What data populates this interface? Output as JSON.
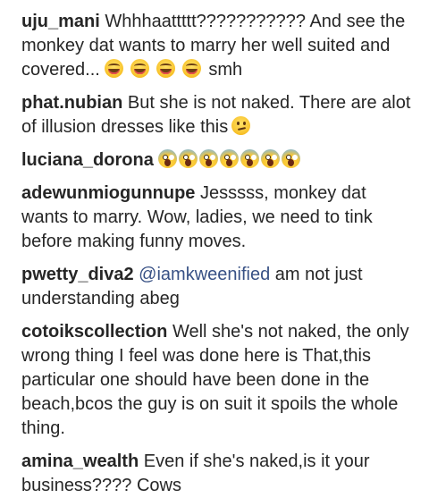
{
  "comments": [
    {
      "username": "uju_mani",
      "text": "Whhhaattttt??????????? And see the monkey dat wants to marry her well suited and covered...",
      "emoji_trailing": [
        "grinning-squinting-face",
        "grinning-squinting-face",
        "grinning-squinting-face",
        "grinning-squinting-face"
      ],
      "suffix": "smh"
    },
    {
      "username": "phat.nubian",
      "text": "But she is not naked. There are alot of illusion dresses like this",
      "emoji_trailing": [
        "smirking-face"
      ]
    },
    {
      "username": "luciana_dorona",
      "text": "",
      "emoji_trailing": [
        "face-screaming-in-fear",
        "face-screaming-in-fear",
        "face-screaming-in-fear",
        "face-screaming-in-fear",
        "face-screaming-in-fear",
        "face-screaming-in-fear",
        "face-screaming-in-fear"
      ]
    },
    {
      "username": "adewunmiogunnupe",
      "text": "Jesssss, monkey dat wants to marry. Wow, ladies, we need to tink before making funny moves."
    },
    {
      "username": "pwetty_diva2",
      "mention": "@iamkweenified",
      "text": "am not just understanding abeg"
    },
    {
      "username": "cotoikscollection",
      "text": "Well she's not naked, the only wrong thing I feel was done here is That,this particular one should have been done in the beach,bcos the guy is on suit it spoils the whole thing."
    },
    {
      "username": "amina_wealth",
      "text": "Even if she's naked,is it your business???? Cows"
    }
  ]
}
